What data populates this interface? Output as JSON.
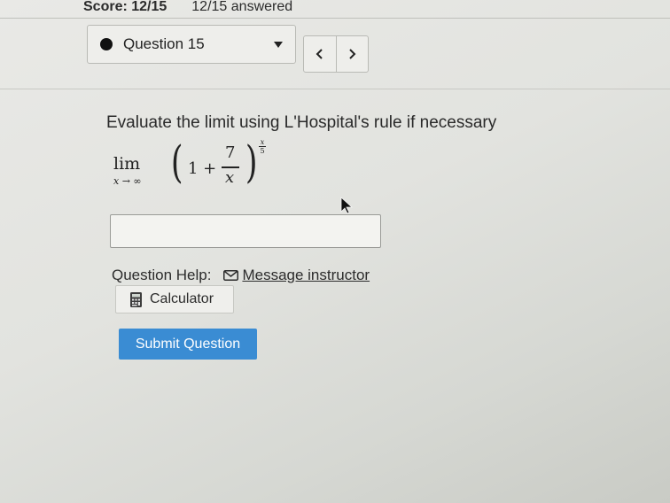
{
  "header": {
    "score": "Score: 12/15",
    "answered": "12/15 answered"
  },
  "question_nav": {
    "selected": "Question 15",
    "prev_icon": "chevron-left-icon",
    "next_icon": "chevron-right-icon"
  },
  "question": {
    "prompt": "Evaluate the limit using L'Hospital's rule if necessary",
    "expression": {
      "lim": "lim",
      "subscript": "x → ∞",
      "left_paren": "(",
      "one_plus": "1 +",
      "numerator": "7",
      "denominator": "x",
      "right_paren": ")",
      "exponent_numerator": "x",
      "exponent_denominator": "5"
    }
  },
  "answer": {
    "value": ""
  },
  "help": {
    "label": "Question Help:",
    "message_link": "Message instructor",
    "calculator": "Calculator"
  },
  "submit": {
    "label": "Submit Question",
    "color": "#3a8cd3"
  }
}
